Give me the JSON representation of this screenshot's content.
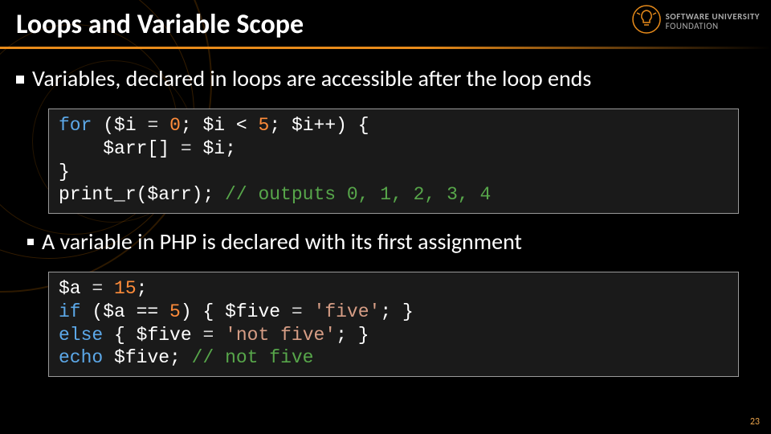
{
  "title": "Loops and Variable Scope",
  "logo": {
    "line1": "SOFTWARE UNIVERSITY",
    "line2": "FOUNDATION"
  },
  "bullets": {
    "b1": "Variables, declared in loops are accessible after the loop ends",
    "b2": "A variable in PHP is declared with its first assignment"
  },
  "code1": {
    "kw_for": "for",
    "open": " (",
    "var_i1": "$i",
    "eq1": " = ",
    "zero": "0",
    "sep1": "; ",
    "var_i2": "$i",
    "lt": " < ",
    "five": "5",
    "sep2": "; ",
    "var_i3": "$i++",
    "close_hdr": ") {",
    "indent": "    ",
    "arr": "$arr[]",
    "eq2": " = ",
    "var_i4": "$i",
    "semicolon": ";",
    "brace_close": "}",
    "print": "print_r",
    "print_args": "($arr); ",
    "comment": "// outputs 0, 1, 2, 3, 4"
  },
  "code2": {
    "a": "$a",
    "eq1": " = ",
    "fifteen": "15",
    "semi": ";",
    "kw_if": "if",
    "open": " (",
    "a2": "$a",
    "eqeq": " == ",
    "five_num": "5",
    "close": ") { ",
    "five_v": "$five",
    "eq2": " = ",
    "str_five": "'five'",
    "tail1": "; }",
    "kw_else": "else",
    "brace": " { ",
    "five_v2": "$five",
    "eq3": " = ",
    "str_not": "'not five'",
    "tail2": "; }",
    "kw_echo": "echo",
    "sp": " ",
    "five_v3": "$five",
    "semi2": "; ",
    "comment": "// not five"
  },
  "page": "23"
}
